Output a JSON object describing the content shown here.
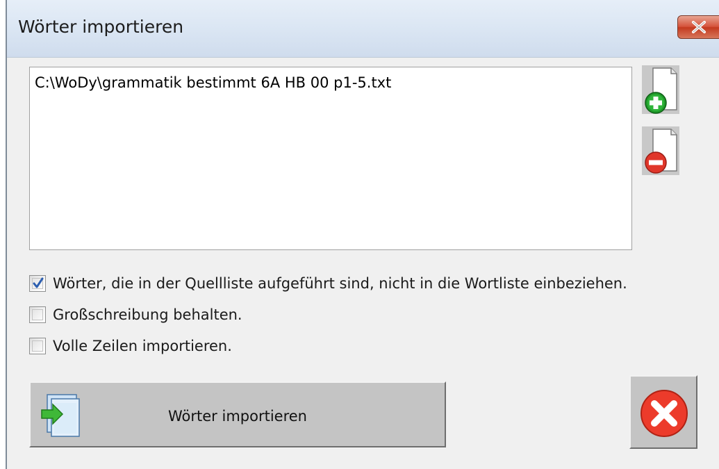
{
  "window": {
    "title": "Wörter importieren"
  },
  "file_list": {
    "items": [
      "C:\\WoDy\\grammatik bestimmt 6A HB 00 p1-5.txt"
    ]
  },
  "options": [
    {
      "label": "Wörter, die in der Quellliste aufgeführt sind, nicht in die Wortliste einbeziehen.",
      "checked": true
    },
    {
      "label": "Großschreibung behalten.",
      "checked": false
    },
    {
      "label": "Volle Zeilen importieren.",
      "checked": false
    }
  ],
  "buttons": {
    "import_label": "Wörter importieren",
    "add_file_icon": "add-file-icon",
    "remove_file_icon": "remove-file-icon",
    "cancel_icon": "cancel-icon"
  },
  "colors": {
    "title_close": "#d5533b",
    "add_green": "#1f9a2a",
    "remove_red": "#e0362a",
    "check_blue": "#2d5fb0"
  }
}
